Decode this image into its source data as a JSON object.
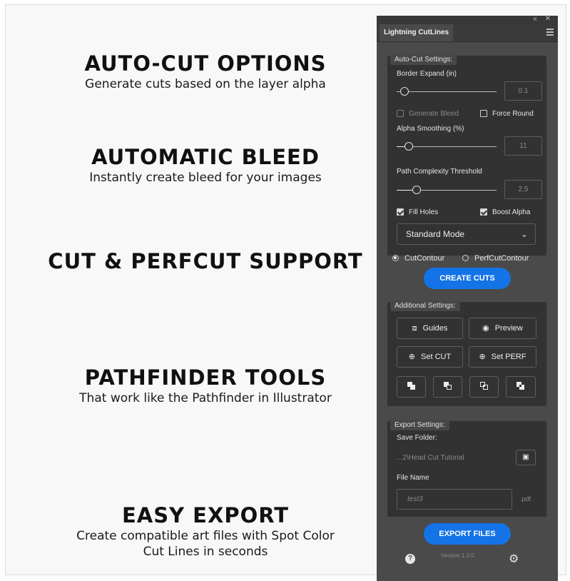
{
  "features": [
    {
      "heading": "AUTO-CUT OPTIONS",
      "sub1": "Generate cuts based on the layer alpha",
      "sub2": ""
    },
    {
      "heading": "AUTOMATIC BLEED",
      "sub1": "Instantly create bleed for your images",
      "sub2": ""
    },
    {
      "heading": "CUT & PERFCUT SUPPORT",
      "sub1": "",
      "sub2": ""
    },
    {
      "heading": "PATHFINDER TOOLS",
      "sub1": "That work like the Pathfinder in Illustrator",
      "sub2": ""
    },
    {
      "heading": "EASY EXPORT",
      "sub1": "Create compatible art files with Spot Color",
      "sub2": "Cut Lines in seconds"
    }
  ],
  "panel": {
    "window_controls": "« ✕",
    "tab_title": "Lightning CutLines",
    "auto_cut": {
      "group_label": "Auto-Cut Settings:",
      "border_expand_label": "Border Expand (in)",
      "border_expand_value": "0.1",
      "generate_bleed_label": "Generate Bleed",
      "force_round_label": "Force Round",
      "alpha_smoothing_label": "Alpha Smoothing (%)",
      "alpha_smoothing_value": "11",
      "path_complexity_label": "Path Complexity Threshold",
      "path_complexity_value": "2.5",
      "fill_holes_label": "Fill Holes",
      "boost_alpha_label": "Boost Alpha",
      "mode_selected": "Standard Mode"
    },
    "cut_type": {
      "cutcontour_label": "CutContour",
      "perfcutcontour_label": "PerfCutContour",
      "selected": "CutContour"
    },
    "create_cuts_label": "CREATE CUTS",
    "additional": {
      "group_label": "Additional Settings:",
      "guides_label": "Guides",
      "preview_label": "Preview",
      "set_cut_label": "Set CUT",
      "set_perf_label": "Set PERF"
    },
    "export": {
      "group_label": "Export Settings:",
      "save_folder_label": "Save Folder:",
      "save_folder_value": "...2\\Head Cut Tutorial",
      "file_name_label": "File Name",
      "file_name_value": "test3",
      "file_ext": ".pdf"
    },
    "export_files_label": "EXPORT FILES",
    "version": "Version 1.0.0",
    "accent_color": "#1473e6"
  }
}
